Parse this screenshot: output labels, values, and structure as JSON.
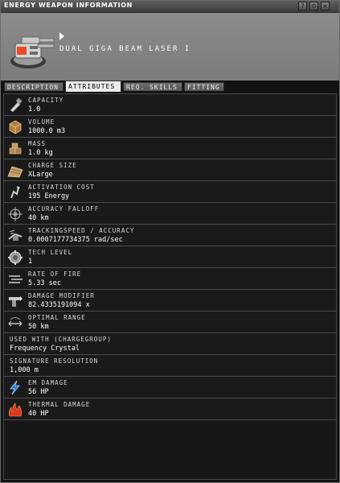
{
  "window": {
    "title": "ENERGY WEAPON INFORMATION",
    "buttons": [
      "?",
      "⊙",
      "×"
    ]
  },
  "item": {
    "name": "DUAL GIGA BEAM LASER I",
    "icon": "dual-laser-turret-icon"
  },
  "tabs": [
    {
      "label": "DESCRIPTION",
      "active": false
    },
    {
      "label": "ATTRIBUTES",
      "active": true
    },
    {
      "label": "REQ. SKILLS",
      "active": false
    },
    {
      "label": "FITTING",
      "active": false
    }
  ],
  "attributes": [
    {
      "label": "CAPACITY",
      "value": "1.0",
      "icon": "capacity-icon"
    },
    {
      "label": "VOLUME",
      "value": "1000.0 m3",
      "icon": "volume-icon"
    },
    {
      "label": "MASS",
      "value": "1.0 kg",
      "icon": "mass-icon"
    },
    {
      "label": "CHARGE SIZE",
      "value": "XLarge",
      "icon": "charge-size-icon"
    },
    {
      "label": "ACTIVATION COST",
      "value": "195 Energy",
      "icon": "activation-cost-icon"
    },
    {
      "label": "ACCURACY FALLOFF",
      "value": "40 km",
      "icon": "accuracy-falloff-icon"
    },
    {
      "label": "TRACKINGSPEED / ACCURACY",
      "value": "0.0007177734375 rad/sec",
      "icon": "tracking-speed-icon"
    },
    {
      "label": "TECH LEVEL",
      "value": "1",
      "icon": "tech-level-icon"
    },
    {
      "label": "RATE OF FIRE",
      "value": "5.33 sec",
      "icon": "rate-of-fire-icon"
    },
    {
      "label": "DAMAGE MODIFIER",
      "value": "82.4335191094 x",
      "icon": "damage-modifier-icon"
    },
    {
      "label": "OPTIMAL RANGE",
      "value": "50 km",
      "icon": "optimal-range-icon"
    },
    {
      "label": "USED WITH (CHARGEGROUP)",
      "value": "Frequency Crystal",
      "icon": ""
    },
    {
      "label": "SIGNATURE RESOLUTION",
      "value": "1,000 m",
      "icon": ""
    },
    {
      "label": "EM DAMAGE",
      "value": "56 HP",
      "icon": "em-damage-icon"
    },
    {
      "label": "THERMAL DAMAGE",
      "value": "40 HP",
      "icon": "thermal-damage-icon"
    }
  ],
  "colors": {
    "em": "#2e7fd6",
    "thermal": "#d9391d",
    "header": "#868686"
  }
}
